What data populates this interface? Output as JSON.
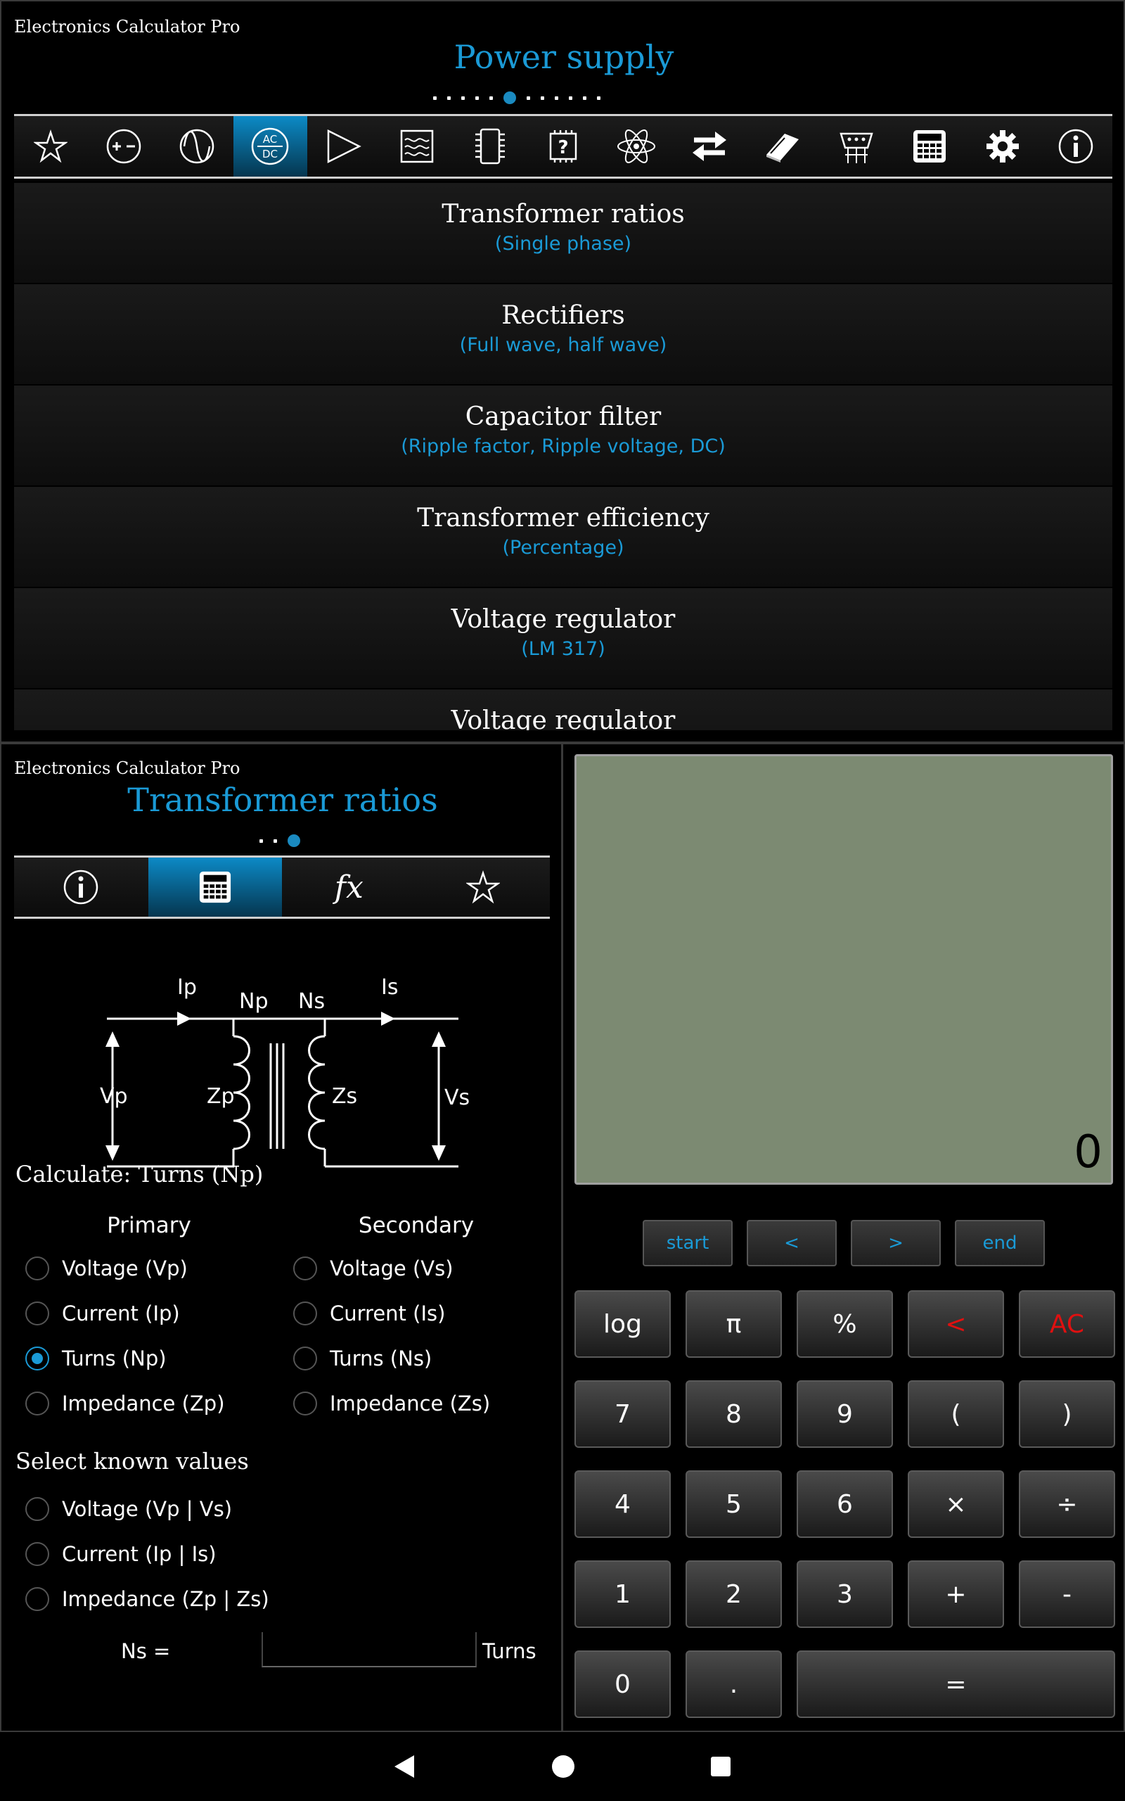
{
  "top": {
    "app_title": "Electronics Calculator Pro",
    "screen_title": "Power supply",
    "page_dots": {
      "count": 12,
      "active": 5
    },
    "icons": [
      "star-icon",
      "plus-minus-icon",
      "sine-wave-icon",
      "ac-dc-icon",
      "triangle-play-icon",
      "filter-waves-icon",
      "chip-icon",
      "question-chip-icon",
      "atom-icon",
      "arrows-exchange-icon",
      "book-icon",
      "connector-icon",
      "calculator-icon",
      "gear-icon",
      "info-icon"
    ],
    "ac_dc_top": "AC",
    "ac_dc_bottom": "DC",
    "items": [
      {
        "title": "Transformer ratios",
        "subtitle": "(Single phase)"
      },
      {
        "title": "Rectifiers",
        "subtitle": "(Full wave, half wave)"
      },
      {
        "title": "Capacitor filter",
        "subtitle": "(Ripple factor, Ripple voltage, DC)"
      },
      {
        "title": "Transformer efficiency",
        "subtitle": "(Percentage)"
      },
      {
        "title": "Voltage regulator",
        "subtitle": "(LM 317)"
      },
      {
        "title": "Voltage regulator",
        "subtitle": ""
      }
    ]
  },
  "bottom_left": {
    "app_title": "Electronics Calculator Pro",
    "screen_title": "Transformer ratios",
    "page_dots": {
      "count": 3,
      "active": 2
    },
    "tabs": [
      "info-icon",
      "calculator-icon",
      "fx-icon",
      "star-icon"
    ],
    "tab_fx_label": "fx",
    "diagram": {
      "Ip": "Ip",
      "Np": "Np",
      "Ns": "Ns",
      "Is": "Is",
      "Vp": "Vp",
      "Zp": "Zp",
      "Zs": "Zs",
      "Vs": "Vs"
    },
    "calculate_label": "Calculate: Turns (Np)",
    "primary_header": "Primary",
    "secondary_header": "Secondary",
    "primary_options": [
      "Voltage (Vp)",
      "Current (Ip)",
      "Turns (Np)",
      "Impedance (Zp)"
    ],
    "secondary_options": [
      "Voltage (Vs)",
      "Current (Is)",
      "Turns (Ns)",
      "Impedance (Zs)"
    ],
    "selected_primary": 2,
    "known_label": "Select known values",
    "known_options": [
      "Voltage (Vp | Vs)",
      "Current (Ip | Is)",
      "Impedance (Zp | Zs)"
    ],
    "ns_label": "Ns =",
    "ns_value": "",
    "ns_unit": "Turns"
  },
  "calculator": {
    "display_value": "0",
    "nav_buttons": [
      "start",
      "<",
      ">",
      "end"
    ],
    "keys": [
      [
        "log",
        "π",
        "%",
        "<",
        "AC"
      ],
      [
        "7",
        "8",
        "9",
        "(",
        ")"
      ],
      [
        "4",
        "5",
        "6",
        "×",
        "÷"
      ],
      [
        "1",
        "2",
        "3",
        "+",
        "-"
      ],
      [
        "0",
        ".",
        "="
      ]
    ]
  },
  "system_nav": [
    "back-icon",
    "home-icon",
    "recents-icon"
  ],
  "colors": {
    "accent": "#1a9ad6",
    "display_bg": "#7c8a72",
    "danger": "#e01010"
  }
}
